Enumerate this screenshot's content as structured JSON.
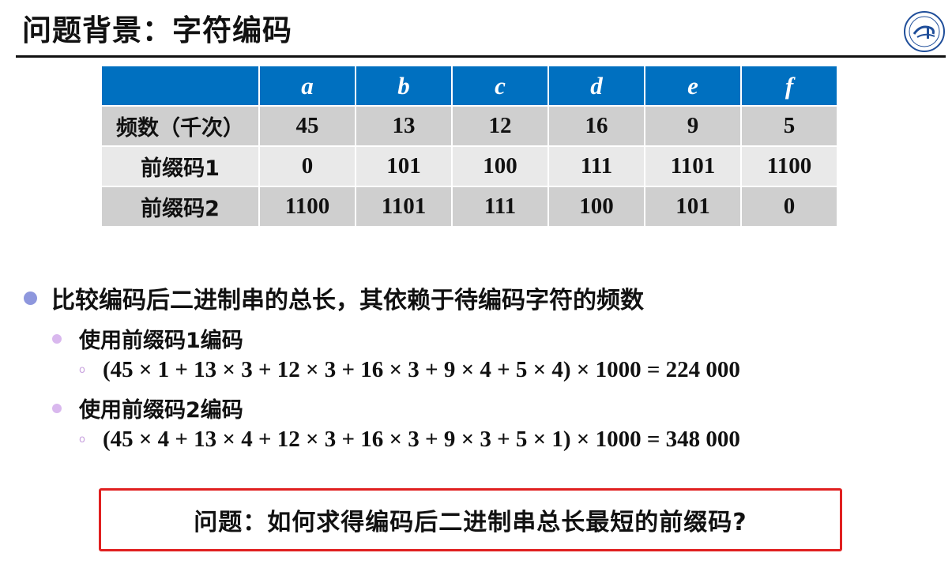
{
  "title": "问题背景：字符编码",
  "colors": {
    "header_blue": "#0070c0",
    "row_dark": "#cfcfcf",
    "row_light": "#e9e9e9",
    "question_border": "#e02020"
  },
  "table": {
    "header": [
      "",
      "a",
      "b",
      "c",
      "d",
      "e",
      "f"
    ],
    "rows": [
      [
        "频数（千次）",
        "45",
        "13",
        "12",
        "16",
        "9",
        "5"
      ],
      [
        "前缀码1",
        "0",
        "101",
        "100",
        "111",
        "1101",
        "1100"
      ],
      [
        "前缀码2",
        "1100",
        "1101",
        "111",
        "100",
        "101",
        "0"
      ]
    ]
  },
  "bullets": {
    "main": "比较编码后二进制串的总长，其依赖于待编码字符的频数",
    "sub1": {
      "label": "使用前缀码1编码",
      "formula": "(45 × 1 + 13 × 3 + 12 × 3 + 16 × 3 + 9 × 4 + 5 × 4) × 1000 = 224 000"
    },
    "sub2": {
      "label": "使用前缀码2编码",
      "formula": "(45 × 4 + 13 × 4 + 12 × 3 + 16 × 3 + 9 × 3 + 5 × 1) × 1000 = 348 000"
    },
    "marker": "o"
  },
  "question": "问题：如何求得编码后二进制串总长最短的前缀码?"
}
